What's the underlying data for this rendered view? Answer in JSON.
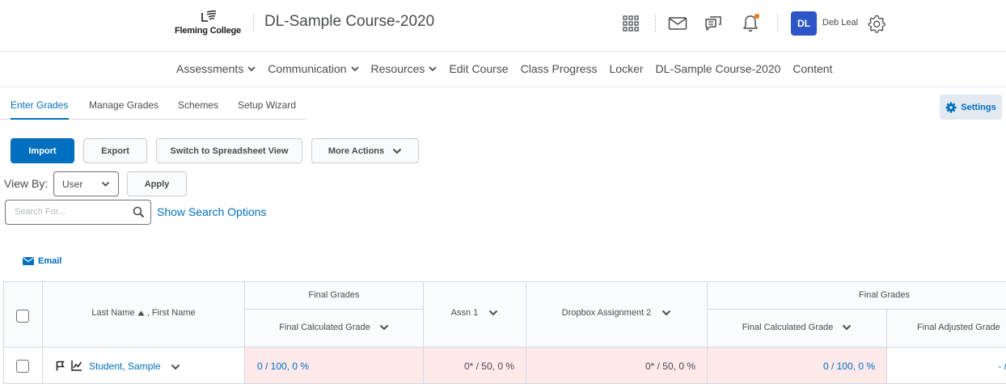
{
  "header": {
    "logo_text": "Fleming College",
    "course_title": "DL-Sample Course-2020",
    "user": {
      "initials": "DL",
      "name": "Deb Leal"
    },
    "notification_color": "#e87511"
  },
  "nav": {
    "items": [
      {
        "label": "Assessments",
        "dropdown": true
      },
      {
        "label": "Communication",
        "dropdown": true
      },
      {
        "label": "Resources",
        "dropdown": true
      },
      {
        "label": "Edit Course",
        "dropdown": false
      },
      {
        "label": "Class Progress",
        "dropdown": false
      },
      {
        "label": "Locker",
        "dropdown": false
      },
      {
        "label": "DL-Sample Course-2020",
        "dropdown": false
      },
      {
        "label": "Content",
        "dropdown": false
      }
    ]
  },
  "tabs": [
    {
      "label": "Enter Grades",
      "active": true
    },
    {
      "label": "Manage Grades",
      "active": false
    },
    {
      "label": "Schemes",
      "active": false
    },
    {
      "label": "Setup Wizard",
      "active": false
    }
  ],
  "settings_label": "Settings",
  "toolbar": {
    "import": "Import",
    "export": "Export",
    "spreadsheet": "Switch to Spreadsheet View",
    "more_actions": "More Actions"
  },
  "view_by": {
    "label": "View By:",
    "selected": "User",
    "apply": "Apply"
  },
  "search": {
    "placeholder": "Search For...",
    "options_link": "Show Search Options"
  },
  "email_label": "Email",
  "table": {
    "group_final_grades": "Final Grades",
    "group_final_grades_2": "Final Grades",
    "name_header": "Last Name",
    "name_header_2": ", First Name",
    "col_final_calc": "Final Calculated Grade",
    "col_assn1": "Assn 1",
    "col_dropbox2": "Dropbox Assignment 2",
    "col_final_calc_2": "Final Calculated Grade",
    "col_final_adjusted": "Final Adjusted Grade",
    "rows": [
      {
        "name": "Student, Sample",
        "final_calc": "0 / 100, 0 %",
        "assn1": "0* / 50, 0 %",
        "dropbox2": "0* / 50, 0 %",
        "final_calc_2": "0 / 100, 0 %",
        "final_adjusted": "- /"
      }
    ]
  },
  "colors": {
    "accent": "#006fbf",
    "avatar": "#2e56c7",
    "grade_cell": "#fde8ea"
  }
}
